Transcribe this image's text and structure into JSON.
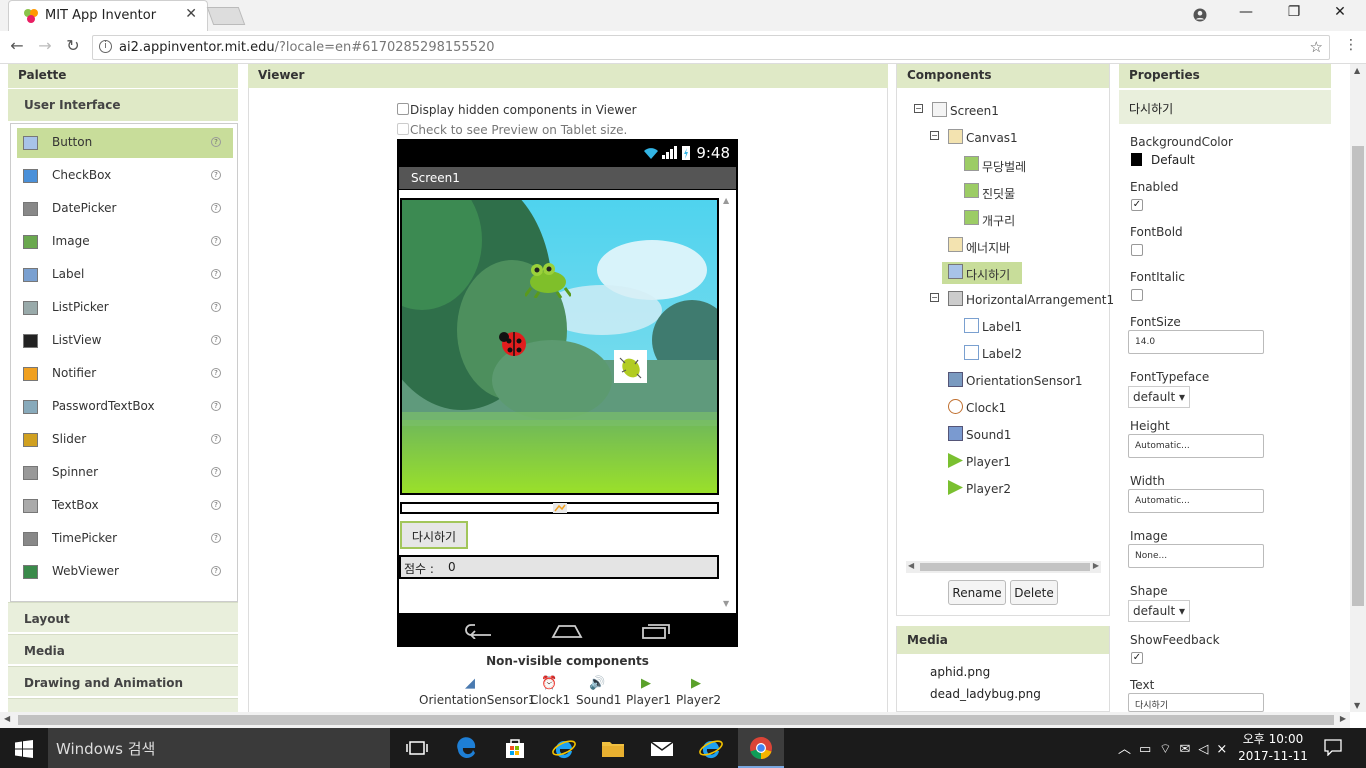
{
  "browser": {
    "tab_title": "MIT App Inventor",
    "url_host": "ai2.appinventor.mit.edu",
    "url_rest": "/?locale=en#6170285298155520"
  },
  "palette": {
    "header": "Palette",
    "category": "User Interface",
    "items": [
      {
        "label": "Button",
        "icon": "button-icon"
      },
      {
        "label": "CheckBox",
        "icon": "checkbox-icon"
      },
      {
        "label": "DatePicker",
        "icon": "datepicker-icon"
      },
      {
        "label": "Image",
        "icon": "image-icon"
      },
      {
        "label": "Label",
        "icon": "label-icon"
      },
      {
        "label": "ListPicker",
        "icon": "listpicker-icon"
      },
      {
        "label": "ListView",
        "icon": "listview-icon"
      },
      {
        "label": "Notifier",
        "icon": "notifier-icon"
      },
      {
        "label": "PasswordTextBox",
        "icon": "password-icon"
      },
      {
        "label": "Slider",
        "icon": "slider-icon"
      },
      {
        "label": "Spinner",
        "icon": "spinner-icon"
      },
      {
        "label": "TextBox",
        "icon": "textbox-icon"
      },
      {
        "label": "TimePicker",
        "icon": "timepicker-icon"
      },
      {
        "label": "WebViewer",
        "icon": "webviewer-icon"
      }
    ],
    "help_glyph": "?",
    "categories": [
      "Layout",
      "Media",
      "Drawing and Animation"
    ]
  },
  "viewer": {
    "header": "Viewer",
    "display_hidden": "Display hidden components in Viewer",
    "tablet_preview": "Check to see Preview on Tablet size.",
    "status_time": "9:48",
    "screen_title": "Screen1",
    "restart_button": "다시하기",
    "score_label": "점수 :",
    "score_value": "0",
    "nonvisible_header": "Non-visible components",
    "nonvisible": [
      {
        "label": "OrientationSensor1",
        "icon": "orientation-sensor-icon"
      },
      {
        "label": "Clock1",
        "icon": "clock-icon"
      },
      {
        "label": "Sound1",
        "icon": "sound-icon"
      },
      {
        "label": "Player1",
        "icon": "player-icon"
      },
      {
        "label": "Player2",
        "icon": "player-icon"
      }
    ]
  },
  "components": {
    "header": "Components",
    "tree": [
      {
        "label": "Screen1",
        "icon": "screen-icon"
      },
      {
        "label": "Canvas1",
        "icon": "canvas-icon"
      },
      {
        "label": "무당벌레",
        "icon": "sprite-icon"
      },
      {
        "label": "진딧물",
        "icon": "sprite-icon"
      },
      {
        "label": "개구리",
        "icon": "sprite-icon"
      },
      {
        "label": "에너지바",
        "icon": "canvas-icon"
      },
      {
        "label": "다시하기",
        "icon": "button-icon"
      },
      {
        "label": "HorizontalArrangement1",
        "icon": "arrangement-icon"
      },
      {
        "label": "Label1",
        "icon": "label-icon"
      },
      {
        "label": "Label2",
        "icon": "label-icon"
      },
      {
        "label": "OrientationSensor1",
        "icon": "orientation-sensor-icon"
      },
      {
        "label": "Clock1",
        "icon": "clock-icon"
      },
      {
        "label": "Sound1",
        "icon": "sound-icon"
      },
      {
        "label": "Player1",
        "icon": "player-icon"
      },
      {
        "label": "Player2",
        "icon": "player-icon"
      }
    ],
    "rename_button": "Rename",
    "delete_button": "Delete"
  },
  "media": {
    "header": "Media",
    "files": [
      "aphid.png",
      "dead_ladybug.png"
    ]
  },
  "properties": {
    "header": "Properties",
    "component": "다시하기",
    "background_color_label": "BackgroundColor",
    "background_color_value": "Default",
    "enabled_label": "Enabled",
    "enabled_checked": true,
    "fontbold_label": "FontBold",
    "fontitalic_label": "FontItalic",
    "fontsize_label": "FontSize",
    "fontsize_value": "14.0",
    "fonttypeface_label": "FontTypeface",
    "fonttypeface_value": "default ▾",
    "height_label": "Height",
    "height_value": "Automatic...",
    "width_label": "Width",
    "width_value": "Automatic...",
    "image_label": "Image",
    "image_value": "None...",
    "shape_label": "Shape",
    "shape_value": "default ▾",
    "showfeedback_label": "ShowFeedback",
    "showfeedback_checked": true,
    "text_label": "Text",
    "text_value": "다시하기"
  },
  "taskbar": {
    "search_placeholder": "Windows 검색",
    "time": "오후 10:00",
    "date": "2017-11-11"
  },
  "colors": {
    "accent_green": "#dfe9c6",
    "selected_green": "#c8dd9a",
    "button_border": "#a2c65a"
  }
}
